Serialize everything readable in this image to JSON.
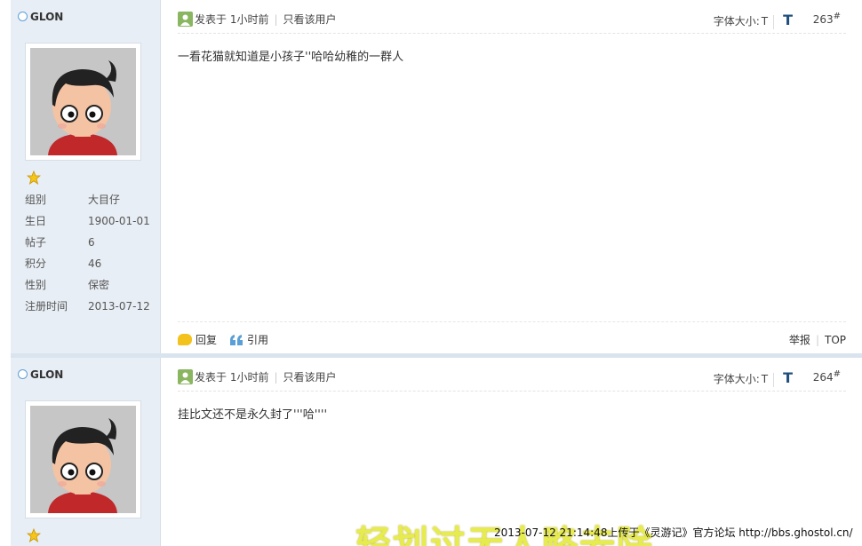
{
  "posts": [
    {
      "username": "GLON",
      "info": [
        {
          "label": "组别",
          "value": "大目仔"
        },
        {
          "label": "生日",
          "value": "1900-01-01"
        },
        {
          "label": "帖子",
          "value": "6"
        },
        {
          "label": "积分",
          "value": "46"
        },
        {
          "label": "性别",
          "value": "保密"
        },
        {
          "label": "注册时间",
          "value": "2013-07-12"
        }
      ],
      "meta_posted": "发表于 1小时前",
      "meta_only_user": "只看该用户",
      "font_size_label": "字体大小:",
      "font_small": "T",
      "font_big": "T",
      "floor": "263",
      "floor_mark": "#",
      "content": "一看花猫就知道是小孩子''哈哈幼稚的一群人",
      "reply": "回复",
      "quote": "引用",
      "report": "举报",
      "top": "TOP"
    },
    {
      "username": "GLON",
      "meta_posted": "发表于 1小时前",
      "meta_only_user": "只看该用户",
      "font_size_label": "字体大小:",
      "font_small": "T",
      "font_big": "T",
      "floor": "264",
      "floor_mark": "#",
      "content": "挂比文还不是永久封了'''哈''''"
    }
  ],
  "overlay": {
    "watermark": "轻划过无人略去除",
    "caption": "2013-07-12 21:14:48上传于《灵游记》官方论坛 http://bbs.ghostol.cn/"
  },
  "colors": {
    "sidebar_bg": "#e8eef5",
    "online_ring": "#5f9fd6",
    "font_big_T": "#1e4f7d",
    "post_icon": "#8ab661",
    "reply_icon": "#f3c21d",
    "star": "#f5c518"
  },
  "icons": [
    "online-status-icon",
    "rank-star-icon",
    "post-user-icon",
    "reply-icon",
    "quote-icon"
  ]
}
